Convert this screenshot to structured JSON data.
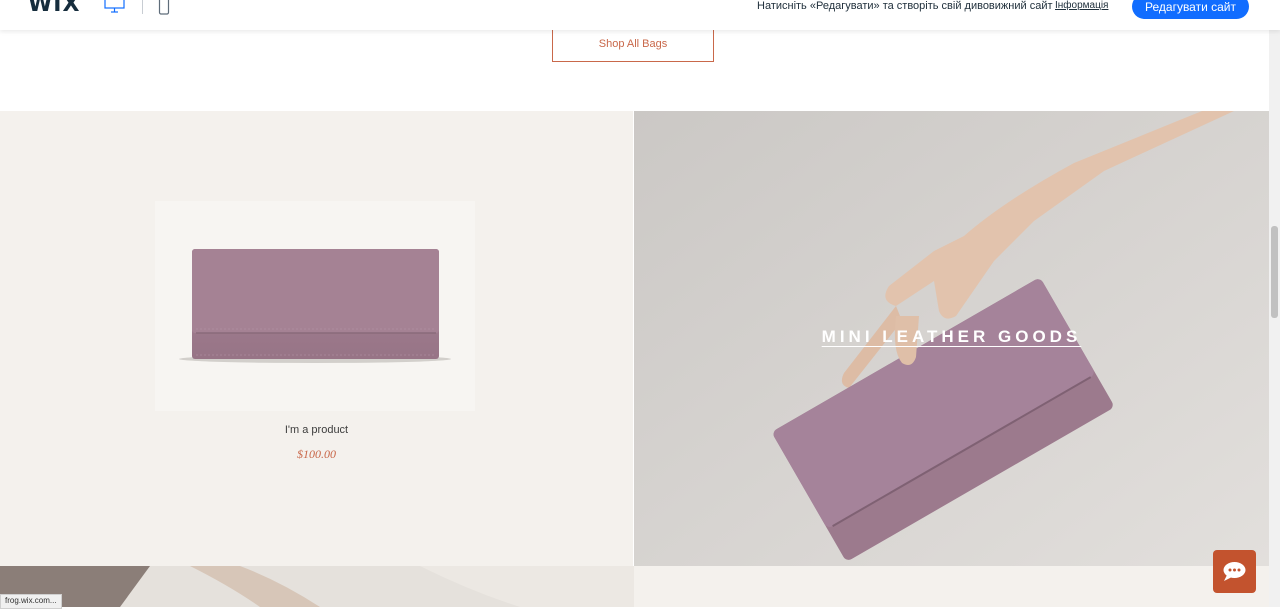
{
  "topbar": {
    "logo": "WIX",
    "notice": "Натисніть «Редагувати» та створіть свій дивовижний сайт",
    "info_link": "Інформація",
    "edit_button": "Редагувати сайт"
  },
  "collection": {
    "shop_button": "Shop All Bags"
  },
  "product": {
    "name": "I'm a product",
    "price": "$100.00"
  },
  "hero": {
    "title": "MINI LEATHER GOODS"
  },
  "status_bar": {
    "url": "frog.wix.com..."
  },
  "colors": {
    "accent": "#c9684a",
    "wix_blue": "#116dff",
    "panel_bg": "#f4f1ed",
    "chat": "#c3532e"
  }
}
